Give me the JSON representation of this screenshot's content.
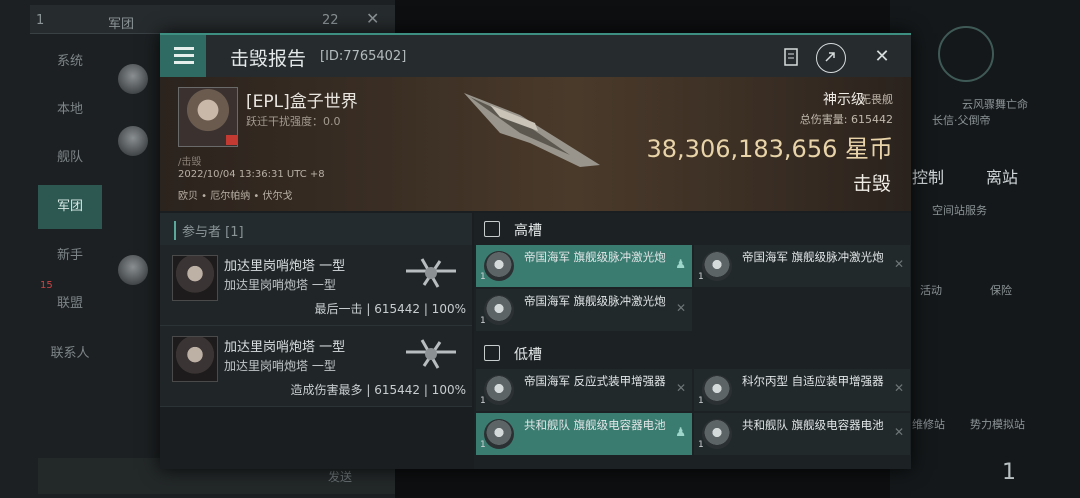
{
  "background": {
    "top_count": "1",
    "top_tab": "军团",
    "top_num": "22",
    "nav": [
      "系统",
      "本地",
      "舰队",
      "军团",
      "新手",
      "联盟",
      "联系人"
    ],
    "nav_badge": "15",
    "bottom_send": "发送",
    "right": {
      "corp_line": "云风骤舞亡命",
      "corp_line2": "长信·父倒帝",
      "control": "控制",
      "undock": "离站",
      "station_service": "空间站服务",
      "activity": "活动",
      "insurance": "保险",
      "repair": "维修站",
      "fitting": "势力模拟站",
      "count": "1"
    }
  },
  "modal": {
    "title": "击毁报告",
    "id": "[ID:7765402]",
    "victim": {
      "pilot": "[EPL]盒子世界",
      "warp": "跃迁干扰强度：0.0",
      "corp": "/击毁",
      "datetime": "2022/10/04 13:36:31 UTC +8",
      "location": "欧贝 • 厄尔帕纳 • 伏尔戈"
    },
    "ship": {
      "name": "神示级",
      "class": "无畏舰",
      "damage_label": "总伤害量: 615442",
      "isk": "38,306,183,656 星币",
      "result": "击毁"
    },
    "participants_header": "参与者 [1]",
    "participants": [
      {
        "name": "加达里岗哨炮塔 一型",
        "ship": "加达里岗哨炮塔 一型",
        "stat": "最后一击 | 615442 | 100%"
      },
      {
        "name": "加达里岗哨炮塔 一型",
        "ship": "加达里岗哨炮塔 一型",
        "stat": "造成伤害最多 | 615442 | 100%"
      }
    ],
    "high_slots_label": "高槽",
    "high_slots": [
      {
        "name": "帝国海军 旗舰级脉冲激光炮",
        "qty": "1"
      },
      {
        "name": "帝国海军 旗舰级脉冲激光炮",
        "qty": "1"
      },
      {
        "name": "帝国海军 旗舰级脉冲激光炮",
        "qty": "1"
      }
    ],
    "low_slots_label": "低槽",
    "low_slots": [
      {
        "name": "帝国海军 反应式装甲增强器",
        "qty": "1"
      },
      {
        "name": "科尔丙型 自适应装甲增强器",
        "qty": "1"
      },
      {
        "name": "共和舰队 旗舰级电容器电池",
        "qty": "1"
      },
      {
        "name": "共和舰队 旗舰级电容器电池",
        "qty": "1"
      }
    ]
  }
}
